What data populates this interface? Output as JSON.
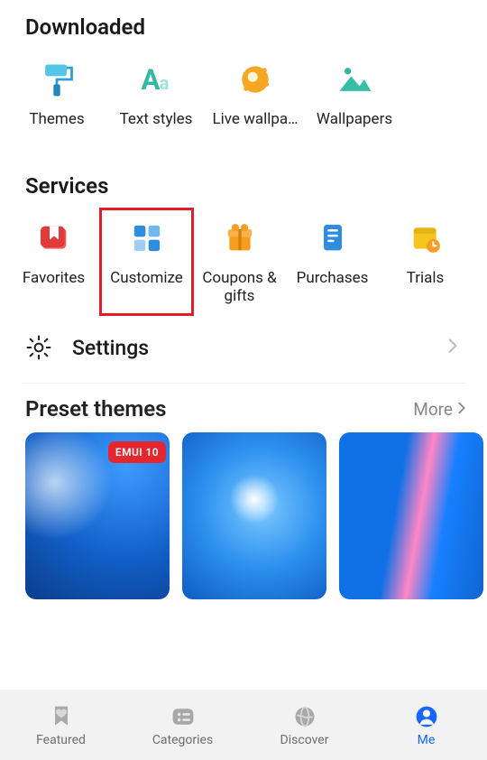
{
  "sections": {
    "downloaded_title": "Downloaded",
    "services_title": "Services",
    "preset_title": "Preset themes",
    "more_label": "More"
  },
  "downloaded": [
    {
      "key": "themes",
      "label": "Themes",
      "icon": "paint-roller"
    },
    {
      "key": "textstyles",
      "label": "Text styles",
      "icon": "text-aa"
    },
    {
      "key": "livewp",
      "label": "Live wallpa…",
      "icon": "live-wallpaper"
    },
    {
      "key": "wallpapers",
      "label": "Wallpapers",
      "icon": "wallpaper"
    }
  ],
  "services": [
    {
      "key": "favorites",
      "label": "Favorites",
      "icon": "bookmark"
    },
    {
      "key": "customize",
      "label": "Customize",
      "icon": "tiles",
      "highlighted": true
    },
    {
      "key": "coupons",
      "label": "Coupons & gifts",
      "icon": "gift"
    },
    {
      "key": "purchases",
      "label": "Purchases",
      "icon": "receipt"
    },
    {
      "key": "trials",
      "label": "Trials",
      "icon": "calendar-clock"
    }
  ],
  "settings_label": "Settings",
  "preset_themes": [
    {
      "badge": "EMUI 10"
    },
    {},
    {}
  ],
  "bottom_nav": [
    {
      "key": "featured",
      "label": "Featured",
      "icon": "heart-bookmark"
    },
    {
      "key": "categories",
      "label": "Categories",
      "icon": "list"
    },
    {
      "key": "discover",
      "label": "Discover",
      "icon": "globe"
    },
    {
      "key": "me",
      "label": "Me",
      "icon": "person",
      "active": true
    }
  ],
  "colors": {
    "accent": "#1866ff",
    "highlight_border": "#e11d2a",
    "badge_bg": "#e6262e"
  }
}
